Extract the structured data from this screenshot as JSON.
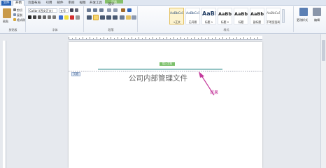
{
  "tabs": [
    "文件",
    "开始",
    "页面布局",
    "引用",
    "邮件",
    "审阅",
    "视图",
    "开发工具",
    "设计"
  ],
  "context_tab_label": "页眉",
  "ribbon": {
    "clipboard": {
      "paste": "粘贴",
      "cut": "剪切",
      "copy": "复制",
      "format_painter": "格式刷",
      "label": "剪贴板"
    },
    "font": {
      "name": "Calibri (西文正文)",
      "size": "五号",
      "label": "字体"
    },
    "paragraph": {
      "label": "段落"
    },
    "styles": {
      "label": "样式",
      "items": [
        {
          "sample": "AaBbCcDd",
          "name": "→正文"
        },
        {
          "sample": "AaBbCcDd",
          "name": "无间隔"
        },
        {
          "sample": "AaBl",
          "name": "标题 1"
        },
        {
          "sample": "AaBbC",
          "name": "标题 2"
        },
        {
          "sample": "AaBbC",
          "name": "标题"
        },
        {
          "sample": "AaBbC",
          "name": "副标题"
        },
        {
          "sample": "AaBbCcDd",
          "name": "不明显强调"
        }
      ],
      "change_styles": "更改样式",
      "edit": "编辑"
    }
  },
  "document": {
    "header_label": "页眉",
    "header_tag": "插入文档",
    "header_text": "公司内部管理文件",
    "annotation": "效果"
  },
  "colors": {
    "accent_line": "#2a8a8a",
    "annotation": "#c43a9c",
    "tag": "#7cc06b"
  }
}
